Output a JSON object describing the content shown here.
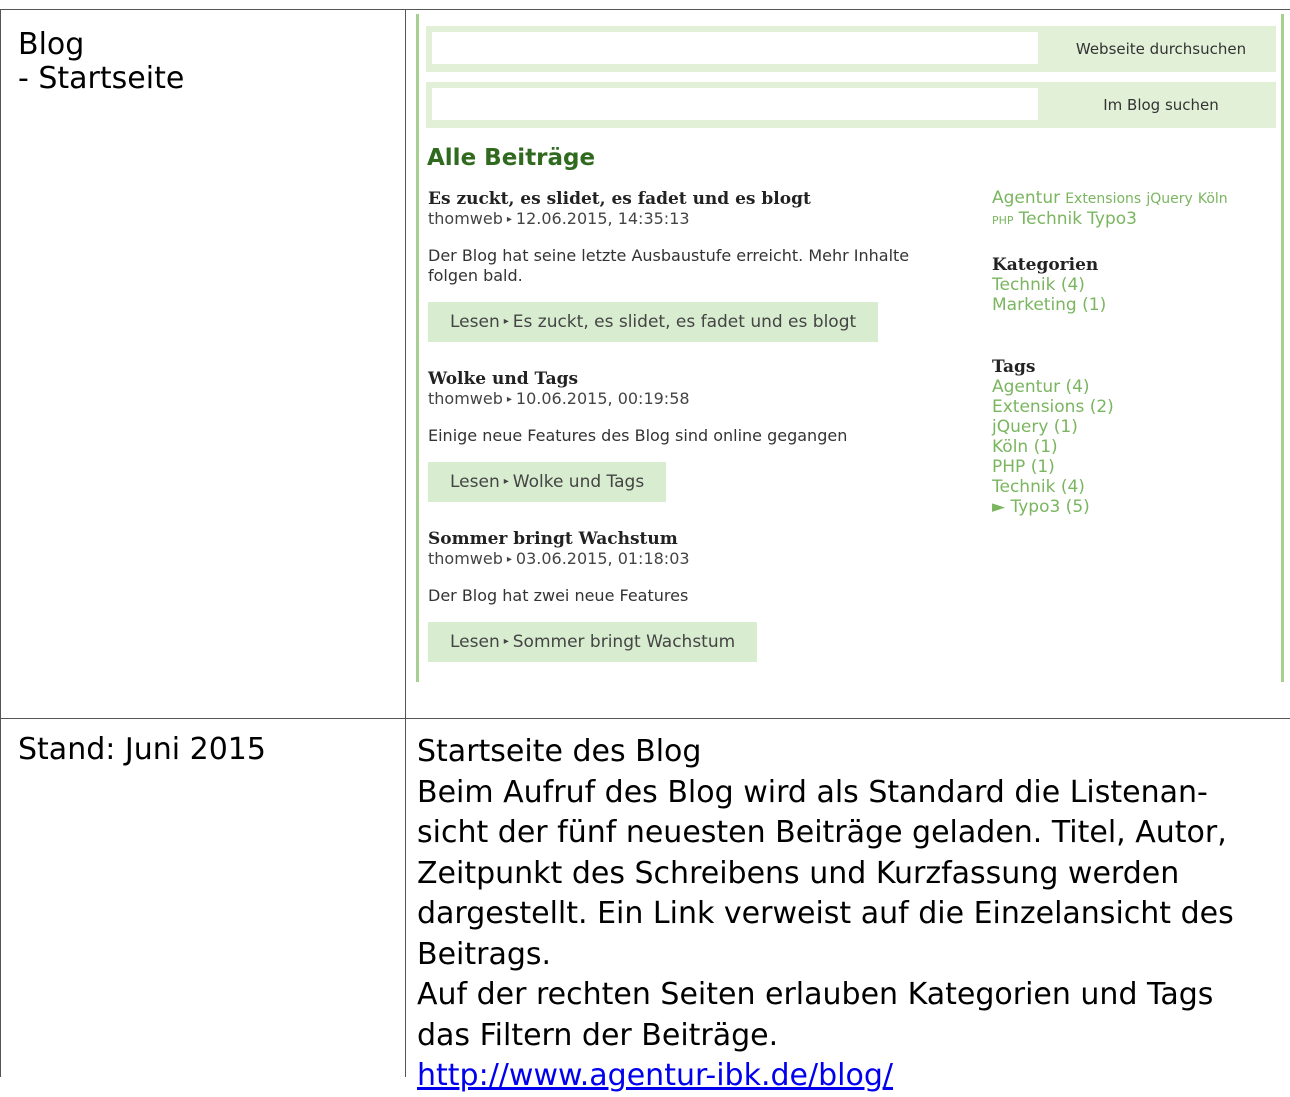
{
  "doc": {
    "left_title_line1": "Blog",
    "left_title_line2": "- Startseite",
    "stand": "Stand: Juni 2015",
    "description": {
      "line1": "Startseite des Blog",
      "line2": "Beim Aufruf des Blog wird als Standard die Listenan-",
      "line3": "sicht der fünf neuesten Beiträge geladen. Titel, Autor,",
      "line4": "Zeitpunkt des Schreibens und Kurzfassung werden",
      "line5": "dargestellt. Ein Link verweist auf die Einzelansicht des",
      "line6": "Beitrags.",
      "line7": "Auf der rechten Seiten erlauben Kategorien und Tags",
      "line8": "das Filtern der Beiträge.",
      "link": "http://www.agentur-ibk.de/blog/"
    }
  },
  "screenshot": {
    "search_site_button": "Webseite durchsuchen",
    "search_blog_button": "Im Blog suchen",
    "heading": "Alle Beiträge",
    "separator": "▸",
    "posts": [
      {
        "title": "Es zuckt, es slidet, es fadet und es blogt",
        "author": "thomweb",
        "date": "12.06.2015, 14:35:13",
        "excerpt_line1": "Der Blog hat seine letzte Ausbaustufe erreicht. Mehr Inhalte",
        "excerpt_line2": "folgen bald.",
        "read_label": "Lesen",
        "read_target": "Es zuckt, es slidet, es fadet und es blogt"
      },
      {
        "title": "Wolke und Tags",
        "author": "thomweb",
        "date": "10.06.2015, 00:19:58",
        "excerpt_line1": "Einige neue Features des Blog sind online gegangen",
        "excerpt_line2": "",
        "read_label": "Lesen",
        "read_target": "Wolke und Tags"
      },
      {
        "title": "Sommer bringt Wachstum",
        "author": "thomweb",
        "date": "03.06.2015, 01:18:03",
        "excerpt_line1": "Der Blog hat zwei neue Features",
        "excerpt_line2": "",
        "read_label": "Lesen",
        "read_target": "Sommer bringt Wachstum"
      }
    ],
    "tagcloud": {
      "agentur": "Agentur",
      "extensions": "Extensions",
      "jquery": "jQuery",
      "koeln": "Köln",
      "php": "PHP",
      "technik": "Technik",
      "typo3": "Typo3"
    },
    "categories_heading": "Kategorien",
    "categories": [
      "Technik (4)",
      "Marketing (1)"
    ],
    "tags_heading": "Tags",
    "tags": [
      "Agentur (4)",
      "Extensions (2)",
      "jQuery (1)",
      "Köln (1)",
      "PHP (1)",
      "Technik (4)",
      "► Typo3 (5)"
    ],
    "colors": {
      "accent_green": "#7ab55f",
      "heading_green": "#2f6a1f",
      "panel_green": "#e2f0d8",
      "button_green": "#d8ecd0",
      "border_green": "#a8cf92"
    }
  }
}
